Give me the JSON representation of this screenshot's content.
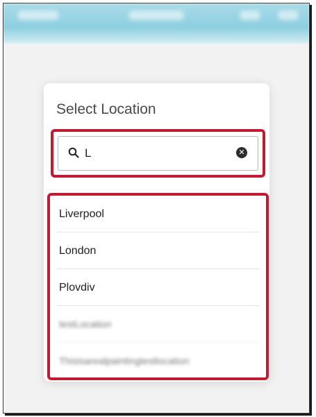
{
  "dialog": {
    "title": "Select Location"
  },
  "search": {
    "value": "L",
    "icon": "search-icon",
    "clear_icon": "clear-icon"
  },
  "results": [
    {
      "label": "Liverpool",
      "blurred": false
    },
    {
      "label": "London",
      "blurred": false
    },
    {
      "label": "Plovdiv",
      "blurred": false
    },
    {
      "label": "testLocation",
      "blurred": true
    },
    {
      "label": "Thisisarealpaintingtestlocation",
      "blurred": true
    }
  ],
  "colors": {
    "highlight": "#c11b34",
    "banner": "#8dcfe0"
  }
}
